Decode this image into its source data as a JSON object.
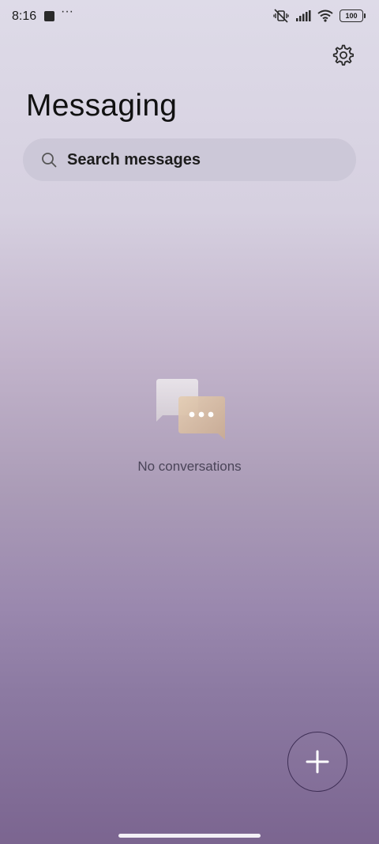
{
  "status_bar": {
    "time": "8:16",
    "battery": "100",
    "icons": [
      "notification-square-icon",
      "more-dots-icon",
      "vibrate-mute-icon",
      "signal-icon",
      "wifi-icon",
      "battery-icon"
    ]
  },
  "header": {
    "title": "Messaging",
    "settings_icon": "gear-icon"
  },
  "search": {
    "placeholder": "Search messages",
    "value": ""
  },
  "empty_state": {
    "message": "No conversations",
    "illustration": "chat-bubbles-icon"
  },
  "fab": {
    "icon": "plus-icon"
  },
  "colors": {
    "accent": "#3e2e55",
    "bubble_back": "#e3dde3",
    "bubble_front": "#d8bfa6"
  }
}
